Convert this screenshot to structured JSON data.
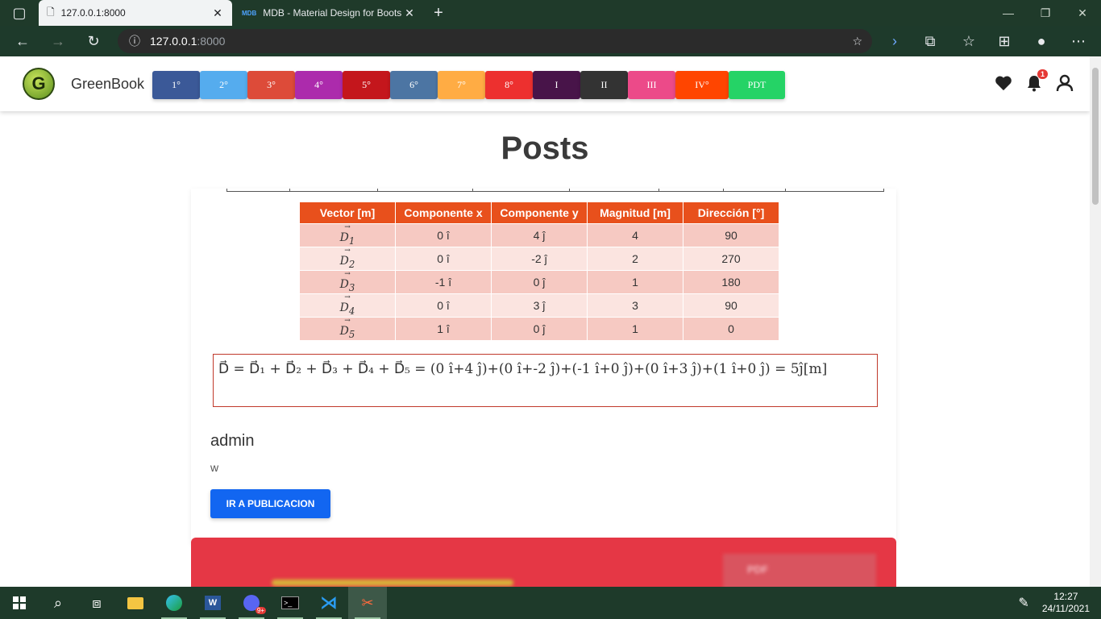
{
  "browser": {
    "tabs": [
      {
        "title": "127.0.0.1:8000",
        "active": true
      },
      {
        "title": "MDB - Material Design for Boots",
        "active": false,
        "favicon": "MDB"
      }
    ],
    "url_host": "127.0.0.1",
    "url_port": ":8000"
  },
  "site": {
    "brand": "GreenBook",
    "logo_letter": "G",
    "grades": [
      {
        "label": "1°",
        "color": "#3b5998"
      },
      {
        "label": "2°",
        "color": "#55acee"
      },
      {
        "label": "3°",
        "color": "#dd4b39"
      },
      {
        "label": "4°",
        "color": "#ac2bac"
      },
      {
        "label": "5°",
        "color": "#c4161c"
      },
      {
        "label": "6°",
        "color": "#4c75a3"
      },
      {
        "label": "7°",
        "color": "#ffac44"
      },
      {
        "label": "8°",
        "color": "#ed302f"
      },
      {
        "label": "I",
        "color": "#481449"
      },
      {
        "label": "II",
        "color": "#333333"
      },
      {
        "label": "III",
        "color": "#ec4a89"
      },
      {
        "label": "IV°",
        "color": "#ff4500"
      },
      {
        "label": "PDT",
        "color": "#25d366"
      }
    ],
    "notification_count": "1"
  },
  "page": {
    "heading": "Posts",
    "post": {
      "table": {
        "headers": [
          "Vector [m]",
          "Componente x",
          "Componente y",
          "Magnitud [m]",
          "Dirección [°]"
        ],
        "rows": [
          [
            "D",
            "1",
            "0 î",
            "4 ĵ",
            "4",
            "90"
          ],
          [
            "D",
            "2",
            "0 î",
            "-2 ĵ",
            "2",
            "270"
          ],
          [
            "D",
            "3",
            "-1 î",
            "0 ĵ",
            "1",
            "180"
          ],
          [
            "D",
            "4",
            "0 î",
            "3 ĵ",
            "3",
            "90"
          ],
          [
            "D",
            "5",
            "1 î",
            "0 ĵ",
            "1",
            "0"
          ]
        ]
      },
      "equation": "D⃗ =  D⃗₁ + D⃗₂ + D⃗₃ + D⃗₄ + D⃗₅ = (0 î+4 ĵ)+(0 î+-2 ĵ)+(-1 î+0 ĵ)+(0 î+3 ĵ)+(1 î+0 ĵ) = 5ĵ[m]",
      "author": "admin",
      "body": "w",
      "button": "IR A PUBLICACION"
    },
    "next_post_label": "PDF"
  },
  "taskbar": {
    "time": "12:27",
    "date": "24/11/2021",
    "discord_badge": "9+"
  }
}
